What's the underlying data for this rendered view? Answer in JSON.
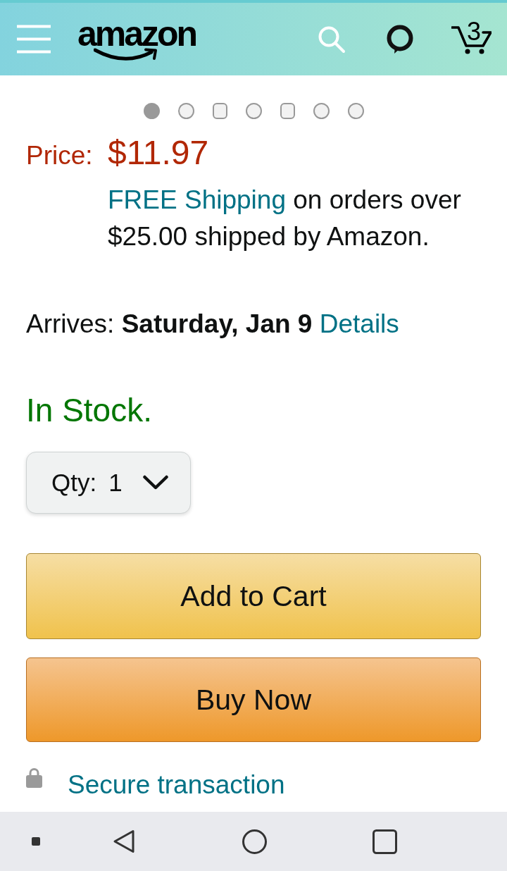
{
  "header": {
    "logo": "amazon",
    "cart_count": "3"
  },
  "carousel": {
    "dots": [
      {
        "kind": "circle",
        "selected": true
      },
      {
        "kind": "circle",
        "selected": false
      },
      {
        "kind": "square",
        "selected": false
      },
      {
        "kind": "circle",
        "selected": false
      },
      {
        "kind": "square",
        "selected": false
      },
      {
        "kind": "circle",
        "selected": false
      },
      {
        "kind": "circle",
        "selected": false
      }
    ]
  },
  "price": {
    "label": "Price:",
    "value": "$11.97"
  },
  "shipping": {
    "link": "FREE Shipping",
    "text": "on orders over $25.00 shipped by Amazon."
  },
  "delivery": {
    "text": "Arrives: **Saturday, Jan 9**",
    "link": "Details"
  },
  "availability": "In Stock.",
  "quantity": {
    "label": "Qty:",
    "value": "1"
  },
  "buttons": [
    {
      "kind": "add_to_cart",
      "label": "Add to Cart"
    },
    {
      "kind": "buy_now",
      "label": "Buy Now"
    }
  ],
  "secure_link": "Secure transaction"
}
